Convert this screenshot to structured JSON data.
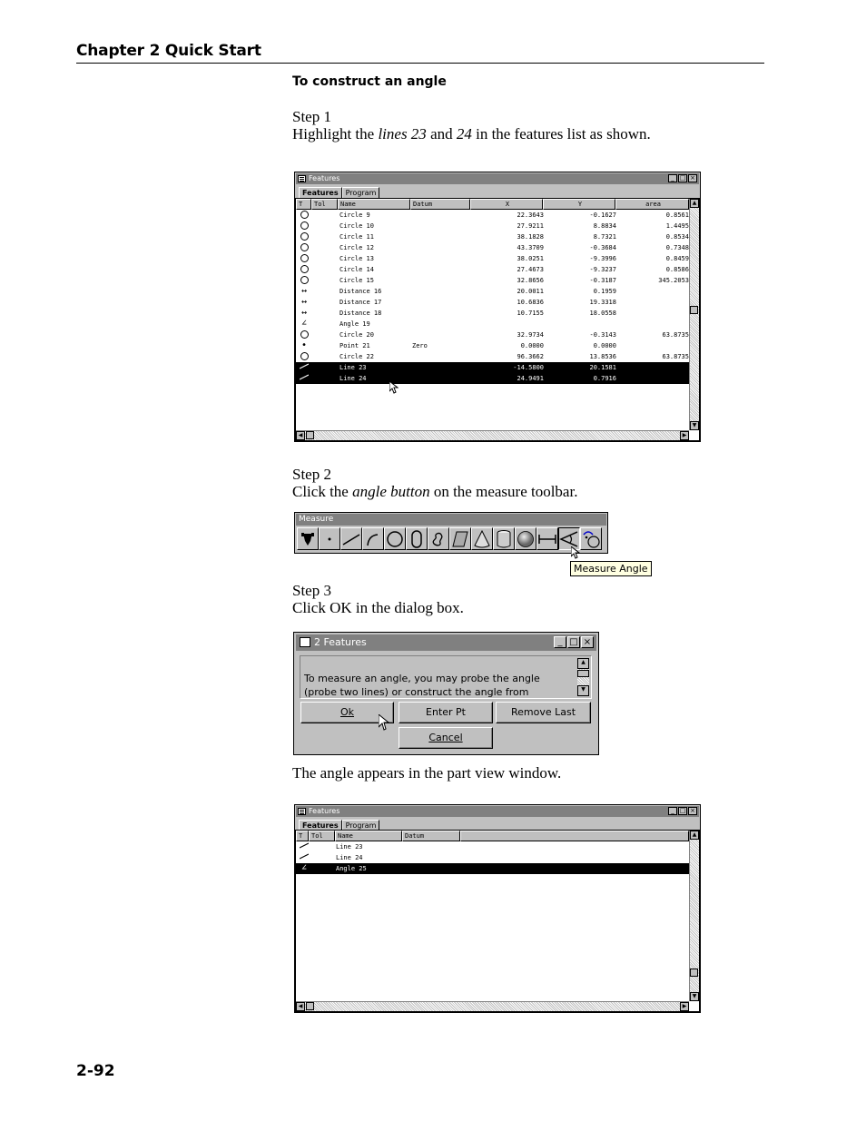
{
  "header": {
    "chapter": "Chapter 2 Quick Start"
  },
  "section_title": "To construct an angle",
  "step1": {
    "label": "Step 1",
    "text_pre": "Highlight the ",
    "em1": "lines 23",
    "mid": " and ",
    "em2": "24",
    "text_post": " in the features list as shown."
  },
  "step2": {
    "label": "Step 2",
    "text_pre": "Click the ",
    "em": "angle button",
    "text_post": " on the measure toolbar."
  },
  "step3": {
    "label": "Step 3",
    "text": "Click OK in the dialog box."
  },
  "result_text": "The angle appears in the part view window.",
  "page_number": "2-92",
  "features_window1": {
    "title": "Features",
    "tabs": [
      "Features",
      "Program"
    ],
    "columns": [
      "T",
      "Tol",
      "Name",
      "Datum",
      "X",
      "Y",
      "area"
    ],
    "rows": [
      {
        "icon": "circle",
        "name": "Circle 9",
        "datum": "",
        "x": "22.3643",
        "y": "-0.1627",
        "area": "0.8561",
        "selected": false
      },
      {
        "icon": "circle",
        "name": "Circle 10",
        "datum": "",
        "x": "27.9211",
        "y": "8.8834",
        "area": "1.4495",
        "selected": false
      },
      {
        "icon": "circle",
        "name": "Circle 11",
        "datum": "",
        "x": "38.1828",
        "y": "8.7321",
        "area": "0.8534",
        "selected": false
      },
      {
        "icon": "circle",
        "name": "Circle 12",
        "datum": "",
        "x": "43.3709",
        "y": "-0.3684",
        "area": "0.7348",
        "selected": false
      },
      {
        "icon": "circle",
        "name": "Circle 13",
        "datum": "",
        "x": "38.0251",
        "y": "-9.3996",
        "area": "0.8459",
        "selected": false
      },
      {
        "icon": "circle",
        "name": "Circle 14",
        "datum": "",
        "x": "27.4673",
        "y": "-9.3237",
        "area": "0.8586",
        "selected": false
      },
      {
        "icon": "circle",
        "name": "Circle 15",
        "datum": "",
        "x": "32.8656",
        "y": "-0.3187",
        "area": "345.2053",
        "selected": false
      },
      {
        "icon": "distance",
        "name": "Distance 16",
        "datum": "",
        "x": "20.0011",
        "y": "0.1959",
        "area": "",
        "selected": false
      },
      {
        "icon": "distance",
        "name": "Distance 17",
        "datum": "",
        "x": "10.6836",
        "y": "19.3318",
        "area": "",
        "selected": false
      },
      {
        "icon": "distance",
        "name": "Distance 18",
        "datum": "",
        "x": "10.7155",
        "y": "18.0558",
        "area": "",
        "selected": false
      },
      {
        "icon": "angle",
        "name": "Angle 19",
        "datum": "",
        "x": "",
        "y": "",
        "area": "",
        "selected": false
      },
      {
        "icon": "circle",
        "name": "Circle 20",
        "datum": "",
        "x": "32.9734",
        "y": "-0.3143",
        "area": "63.8735",
        "selected": false
      },
      {
        "icon": "point",
        "name": "Point 21",
        "datum": "Zero",
        "x": "0.0000",
        "y": "0.0000",
        "area": "",
        "selected": false
      },
      {
        "icon": "circle",
        "name": "Circle 22",
        "datum": "",
        "x": "96.3662",
        "y": "13.8536",
        "area": "63.8735",
        "selected": false
      },
      {
        "icon": "line",
        "name": "Line 23",
        "datum": "",
        "x": "-14.5800",
        "y": "20.1581",
        "area": "",
        "selected": true
      },
      {
        "icon": "line",
        "name": "Line 24",
        "datum": "",
        "x": "24.9491",
        "y": "0.7916",
        "area": "",
        "selected": true
      }
    ]
  },
  "measure_toolbar": {
    "title": "Measure",
    "tools": [
      "probe-icon",
      "point-icon",
      "line-icon",
      "arc-icon",
      "circle-icon",
      "slot-icon",
      "contour-icon",
      "plane-icon",
      "cone-icon",
      "cylinder-icon",
      "sphere-icon",
      "distance-icon",
      "angle-icon",
      "custom-icon"
    ],
    "tooltip": "Measure Angle"
  },
  "dialog": {
    "title": "2 Features",
    "message": "To measure an angle, you may probe the angle\n(probe two lines) or construct the angle from",
    "ok": "Ok",
    "enter_pt": "Enter Pt",
    "remove_last": "Remove Last",
    "cancel": "Cancel"
  },
  "features_window2": {
    "title": "Features",
    "tabs": [
      "Features",
      "Program"
    ],
    "columns": [
      "T",
      "Tol",
      "Name",
      "Datum"
    ],
    "rows": [
      {
        "icon": "line",
        "name": "Line 23",
        "selected": false
      },
      {
        "icon": "line",
        "name": "Line 24",
        "selected": false
      },
      {
        "icon": "angle",
        "name": "Angle 25",
        "selected": true
      }
    ]
  }
}
